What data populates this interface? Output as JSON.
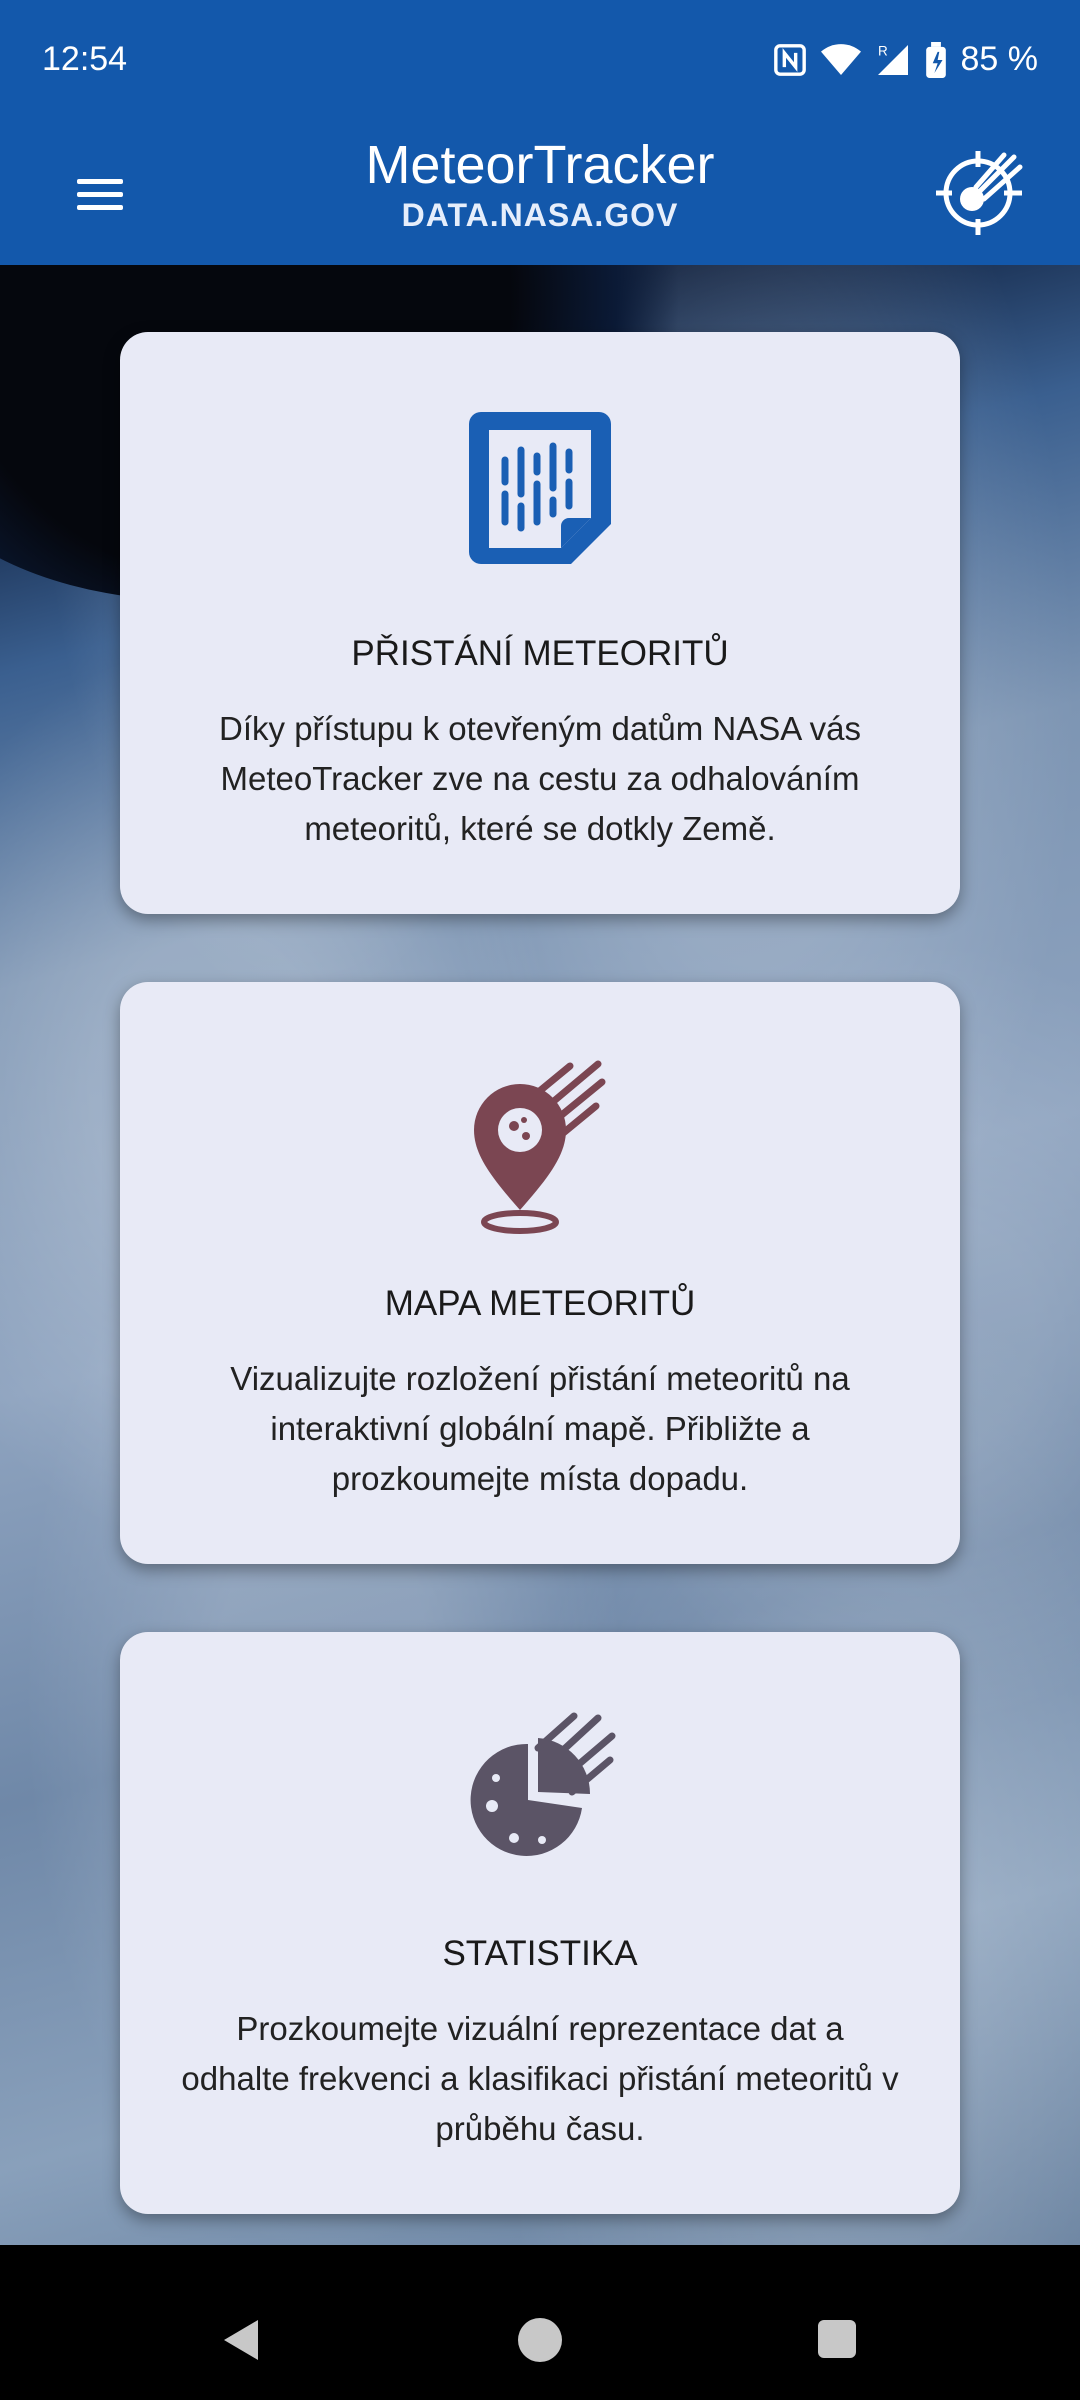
{
  "status_bar": {
    "time": "12:54",
    "battery_percent": "85 %",
    "icons": [
      "nfc-icon",
      "wifi-icon",
      "signal-icon",
      "battery-icon"
    ]
  },
  "app_bar": {
    "title": "MeteorTracker",
    "subtitle": "DATA.NASA.GOV",
    "menu_icon": "hamburger-menu-icon",
    "logo_icon": "meteor-crosshair-icon",
    "color": "#1358ab"
  },
  "cards": [
    {
      "title": "PŘISTÁNÍ METEORITŮ",
      "description": "Díky přístupu k otevřeným datům NASA vás MeteoTracker zve na cestu za odhalováním meteoritů, které se dotkly Země.",
      "icon": "data-document-icon",
      "icon_color": "#1a5fb4"
    },
    {
      "title": "MAPA METEORITŮ",
      "description": "Vizualizujte rozložení přistání meteoritů na interaktivní globální mapě. Přibližte a prozkoumejte místa dopadu.",
      "icon": "meteor-map-pin-icon",
      "icon_color": "#7b4652"
    },
    {
      "title": "STATISTIKA",
      "description": "Prozkoumejte vizuální reprezentace dat a odhalte frekvenci a klasifikaci přistání meteoritů v průběhu času.",
      "icon": "meteor-pie-chart-icon",
      "icon_color": "#5b5466"
    }
  ],
  "nav_bar": {
    "icons": [
      "back-icon",
      "home-icon",
      "recent-apps-icon"
    ]
  }
}
